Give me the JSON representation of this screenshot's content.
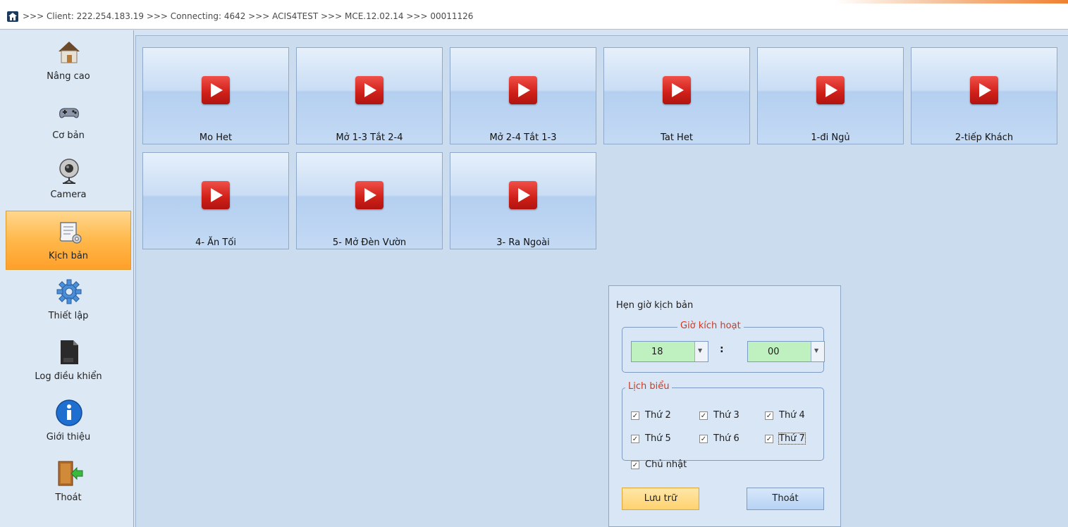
{
  "topbar": {
    "path": ">>> Client: 222.254.183.19 >>> Connecting: 4642 >>> ACIS4TEST >>> MCE.12.02.14 >>> 00011126"
  },
  "sidebar": {
    "items": [
      {
        "label": "Nâng cao",
        "icon": "house-icon"
      },
      {
        "label": "Cơ bản",
        "icon": "gamepad-icon"
      },
      {
        "label": "Camera",
        "icon": "webcam-icon"
      },
      {
        "label": "Kịch bản",
        "icon": "script-scroll-icon",
        "active": true
      },
      {
        "label": "Thiết lập",
        "icon": "gear-icon"
      },
      {
        "label": "Log điều khiển",
        "icon": "log-file-icon"
      },
      {
        "label": "Giới thiệu",
        "icon": "info-icon"
      },
      {
        "label": "Thoát",
        "icon": "exit-door-icon"
      }
    ]
  },
  "scenes": [
    {
      "label": "Mo Het"
    },
    {
      "label": "Mở 1-3 Tắt 2-4"
    },
    {
      "label": "Mở 2-4 Tắt 1-3"
    },
    {
      "label": "Tat Het"
    },
    {
      "label": "1-đi Ngủ"
    },
    {
      "label": "2-tiếp Khách"
    },
    {
      "label": "4- Ăn Tối"
    },
    {
      "label": "5- Mở Đèn Vườn"
    },
    {
      "label": "3- Ra Ngoài"
    }
  ],
  "timer_dialog": {
    "title": "Hẹn giờ kịch bản",
    "activation_group": "Giờ kích hoạt",
    "hour": "18",
    "separator": ":",
    "minute": "00",
    "schedule_group": "Lịch biểu",
    "days": [
      {
        "label": "Thứ 2",
        "checked": true
      },
      {
        "label": "Thứ 3",
        "checked": true
      },
      {
        "label": "Thứ 4",
        "checked": true
      },
      {
        "label": "Thứ 5",
        "checked": true
      },
      {
        "label": "Thứ 6",
        "checked": true
      },
      {
        "label": "Thứ 7",
        "checked": true
      },
      {
        "label": "Chủ nhật",
        "checked": true
      }
    ],
    "save_label": "Lưu trữ",
    "exit_label": "Thoát"
  },
  "colors": {
    "accent_active": "#ffb84a",
    "play_red": "#cf1f18",
    "group_title": "#d2381f",
    "combo_bg": "#bff0bf"
  }
}
